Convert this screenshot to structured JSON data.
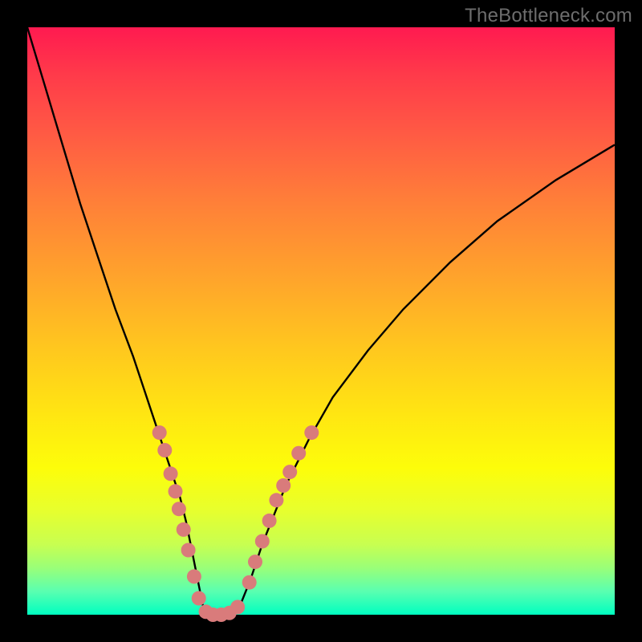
{
  "watermark": "TheBottleneck.com",
  "colors": {
    "frame": "#000000",
    "curve": "#000000",
    "marker_fill": "#d97b7b",
    "marker_stroke": "#bb4f4f"
  },
  "chart_data": {
    "type": "line",
    "title": "",
    "xlabel": "",
    "ylabel": "",
    "xlim": [
      0,
      100
    ],
    "ylim": [
      0,
      100
    ],
    "grid": false,
    "series": [
      {
        "name": "bottleneck-curve",
        "x": [
          0,
          3,
          6,
          9,
          12,
          15,
          18,
          20,
          22,
          24,
          26,
          27,
          28,
          29,
          30,
          32,
          34,
          36,
          38,
          40,
          44,
          48,
          52,
          58,
          64,
          72,
          80,
          90,
          100
        ],
        "y": [
          100,
          90,
          80,
          70,
          61,
          52,
          44,
          38,
          32,
          26,
          20,
          16,
          11,
          6,
          1,
          0,
          0,
          1,
          6,
          12,
          22,
          30,
          37,
          45,
          52,
          60,
          67,
          74,
          80
        ]
      }
    ],
    "markers": {
      "name": "highlighted-points",
      "points": [
        {
          "x": 22.5,
          "y": 31
        },
        {
          "x": 23.4,
          "y": 28
        },
        {
          "x": 24.4,
          "y": 24
        },
        {
          "x": 25.2,
          "y": 21
        },
        {
          "x": 25.8,
          "y": 18
        },
        {
          "x": 26.6,
          "y": 14.5
        },
        {
          "x": 27.4,
          "y": 11
        },
        {
          "x": 28.4,
          "y": 6.5
        },
        {
          "x": 29.2,
          "y": 2.8
        },
        {
          "x": 30.4,
          "y": 0.5
        },
        {
          "x": 31.6,
          "y": 0
        },
        {
          "x": 33.0,
          "y": 0
        },
        {
          "x": 34.4,
          "y": 0.3
        },
        {
          "x": 35.8,
          "y": 1.3
        },
        {
          "x": 37.8,
          "y": 5.5
        },
        {
          "x": 38.8,
          "y": 9
        },
        {
          "x": 40.0,
          "y": 12.5
        },
        {
          "x": 41.2,
          "y": 16
        },
        {
          "x": 42.4,
          "y": 19.5
        },
        {
          "x": 43.6,
          "y": 22
        },
        {
          "x": 44.7,
          "y": 24.3
        },
        {
          "x": 46.2,
          "y": 27.5
        },
        {
          "x": 48.4,
          "y": 31
        }
      ]
    }
  }
}
